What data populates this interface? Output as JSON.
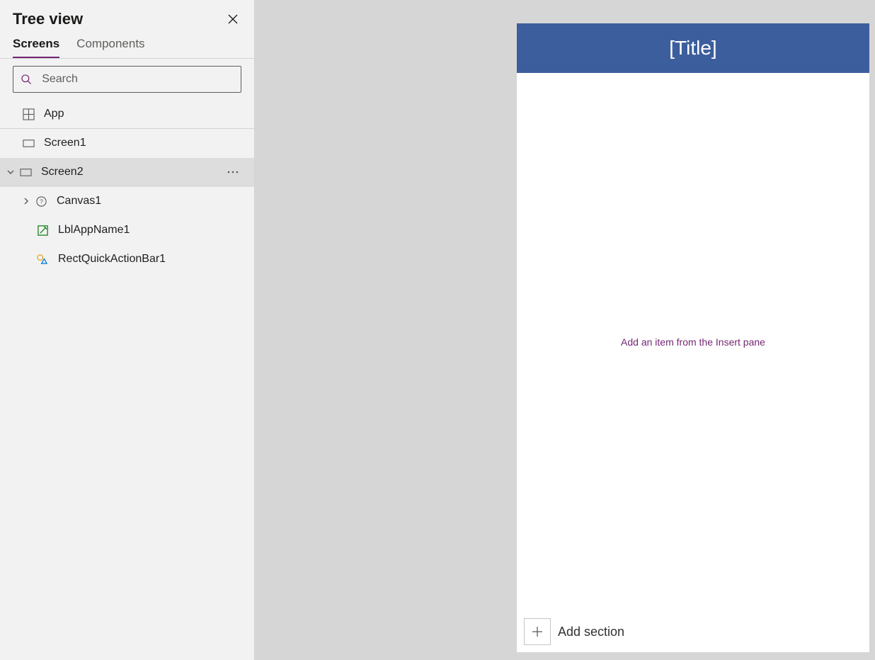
{
  "tree": {
    "title": "Tree view",
    "tabs": {
      "screens": "Screens",
      "components": "Components"
    },
    "search_placeholder": "Search",
    "items": {
      "app": "App",
      "screen1": "Screen1",
      "screen2": "Screen2",
      "canvas1": "Canvas1",
      "lblappname1": "LblAppName1",
      "rectquickactionbar1": "RectQuickActionBar1"
    }
  },
  "canvas": {
    "title": "[Title]",
    "hint": "Add an item from the Insert pane",
    "add_section": "Add section",
    "titlebar_color": "#3d5e9c"
  }
}
